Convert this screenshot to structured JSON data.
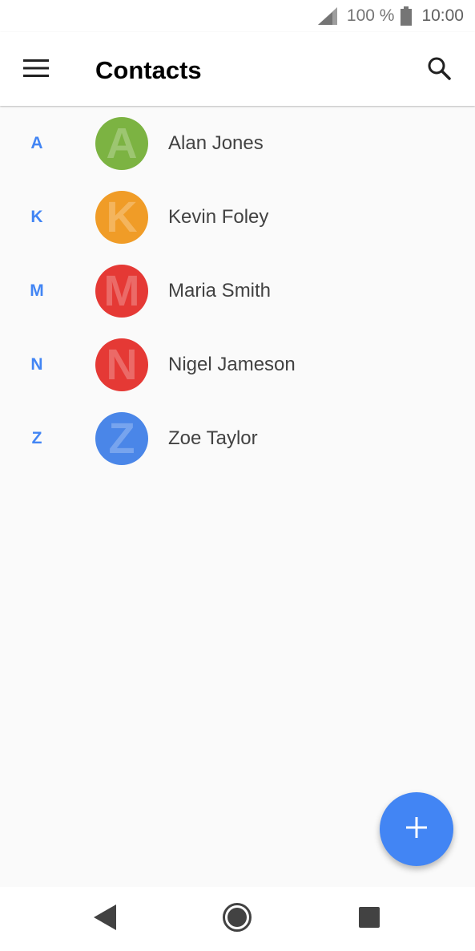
{
  "status_bar": {
    "battery_percent": "100 %",
    "time": "10:00"
  },
  "app_bar": {
    "title": "Contacts"
  },
  "contacts": [
    {
      "section": "A",
      "name": "Alan Jones",
      "avatar_letter": "A",
      "avatar_color": "#7cb342"
    },
    {
      "section": "K",
      "name": "Kevin Foley",
      "avatar_letter": "K",
      "avatar_color": "#f09c27"
    },
    {
      "section": "M",
      "name": "Maria Smith",
      "avatar_letter": "M",
      "avatar_color": "#e53935"
    },
    {
      "section": "N",
      "name": "Nigel Jameson",
      "avatar_letter": "N",
      "avatar_color": "#e53935"
    },
    {
      "section": "Z",
      "name": "Zoe Taylor",
      "avatar_letter": "Z",
      "avatar_color": "#4a86e8"
    }
  ],
  "colors": {
    "accent": "#4285f4",
    "section_letter": "#4285f4",
    "fab": "#4285f4"
  },
  "icons": {
    "menu": "hamburger-icon",
    "search": "search-icon",
    "fab": "plus-icon",
    "back": "back-triangle-icon",
    "home": "home-circle-icon",
    "recents": "recents-square-icon"
  }
}
